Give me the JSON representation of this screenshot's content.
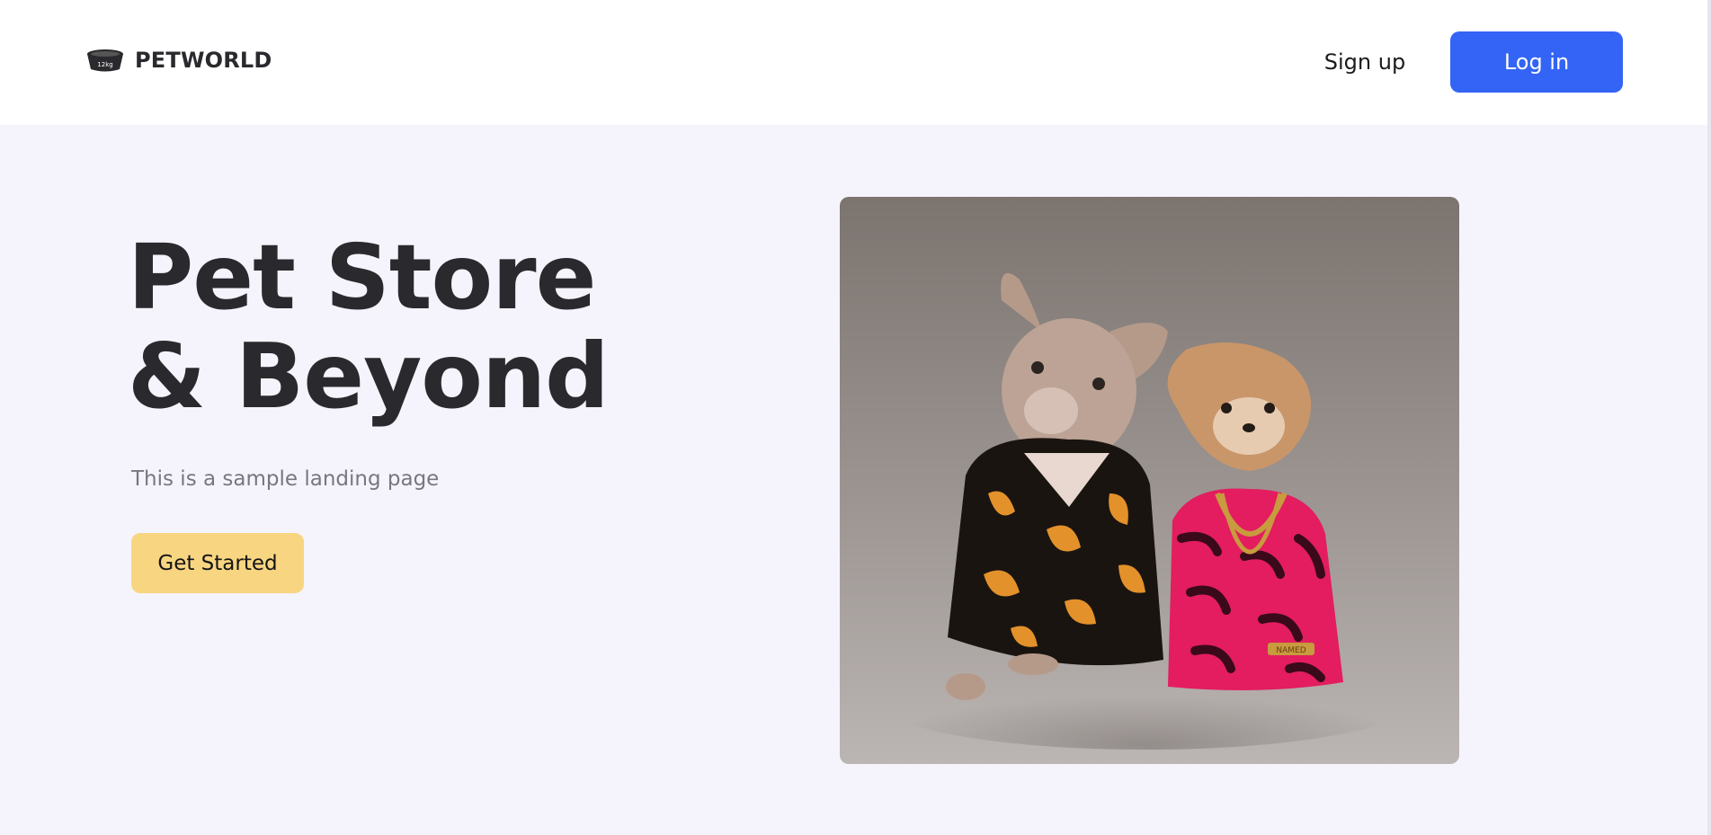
{
  "brand": {
    "name": "PETWORLD",
    "icon": "pet-bowl-icon",
    "icon_text": "12kg"
  },
  "nav": {
    "signup_label": "Sign up",
    "login_label": "Log in"
  },
  "hero": {
    "title_line1": "Pet Store",
    "title_line2": "& Beyond",
    "subtitle": "This is a sample landing page",
    "cta_label": "Get Started",
    "image_tag": "NAMED"
  },
  "colors": {
    "header_bg": "#ffffff",
    "page_bg": "#f5f4fc",
    "primary": "#3364f5",
    "cta": "#f8d581",
    "title_text": "#2a2a2e",
    "subtitle_text": "#77777f"
  }
}
